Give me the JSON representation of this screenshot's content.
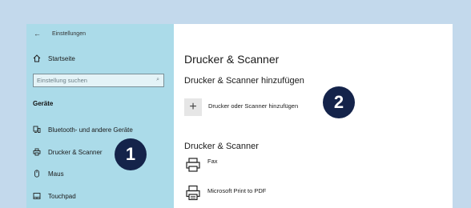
{
  "sidebar": {
    "back_label": "Einstellungen",
    "home_label": "Startseite",
    "search_placeholder": "Einstellung suchen",
    "section_label": "Geräte",
    "items": [
      {
        "label": "Bluetooth- und andere Geräte",
        "icon": "bluetooth-devices-icon"
      },
      {
        "label": "Drucker & Scanner",
        "icon": "printer-icon"
      },
      {
        "label": "Maus",
        "icon": "mouse-icon"
      },
      {
        "label": "Touchpad",
        "icon": "touchpad-icon"
      }
    ]
  },
  "main": {
    "title": "Drucker & Scanner",
    "add_heading": "Drucker & Scanner hinzufügen",
    "add_button_label": "Drucker oder Scanner hinzufügen",
    "list_heading": "Drucker & Scanner",
    "printers": [
      {
        "name": "Fax",
        "icon": "fax-printer-icon"
      },
      {
        "name": "Microsoft Print to PDF",
        "icon": "pdf-printer-icon"
      }
    ]
  },
  "annotations": {
    "badge_1": "1",
    "badge_2": "2"
  },
  "colors": {
    "background": "#c3d9ec",
    "sidebar": "#abdbe9",
    "badge": "#14234a"
  }
}
